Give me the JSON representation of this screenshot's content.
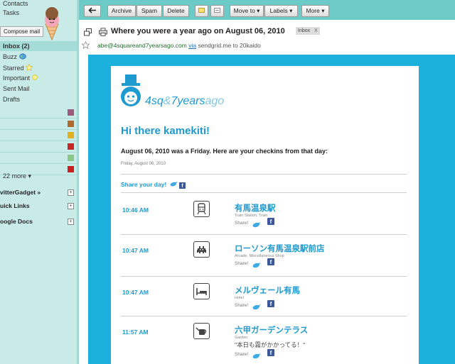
{
  "sidebar": {
    "nav": [
      "Contacts",
      "Tasks"
    ],
    "compose_label": "Compose mail",
    "inbox_label": "Inbox (2)",
    "buzz_label": "Buzz",
    "starred_label": "Starred",
    "important_label": "Important",
    "sent_label": "Sent Mail",
    "drafts_label": "Drafts",
    "label_colors": [
      "#9c5a7d",
      "#b06a2c",
      "#e0b021",
      "#c62828",
      "#8bc689",
      "#cc1f1f"
    ],
    "more_label": "22 more ▾",
    "gadgets": [
      "vitterGadget »",
      "uick Links",
      "oogle Docs"
    ]
  },
  "toolbar": {
    "back_icon": "back-arrow-icon",
    "archive": "Archive",
    "spam": "Spam",
    "delete": "Delete",
    "move_to": "Move to ▾",
    "labels": "Labels ▾",
    "more": "More ▾"
  },
  "header": {
    "subject": "Where you were a year ago on August 06, 2010",
    "inbox_tag": "Inbox",
    "inbox_tag_x": "X",
    "sender": "abe@4squareand7yearsago.com",
    "via": "via",
    "via_domain": "sendgrid.me",
    "to": "to 20kaido"
  },
  "email": {
    "logo_text_a": "4sq",
    "logo_text_amp": "&",
    "logo_text_b": "7years",
    "logo_text_c": "ago",
    "greeting": "Hi there kamekiti!",
    "intro": "August 06, 2010 was a Friday. Here are your checkins from that day:",
    "date": "Friday, August 06, 2010",
    "share_day": "Share your day!",
    "accent": "#1d9ad0",
    "frame_color": "#1cb1dd"
  },
  "checkins": [
    {
      "time": "10:46 AM",
      "venue": "有馬温泉駅",
      "category": "Train Station, Train",
      "share": "Share!",
      "icon": "train-icon"
    },
    {
      "time": "10:47 AM",
      "venue": "ローソン有馬温泉駅前店",
      "category": "Arcade, Miscellaneous Shop",
      "share": "Share!",
      "icon": "arcade-invader-icon"
    },
    {
      "time": "10:47 AM",
      "venue": "メルヴェール有馬",
      "category": "Hotel",
      "share": "Share!",
      "icon": "hotel-bed-icon"
    },
    {
      "time": "11:57 AM",
      "venue": "六甲ガーデンテラス",
      "category": "Garden",
      "shout": "\"本日も霧がかかってる！\"",
      "share": "Share!",
      "icon": "watering-can-icon"
    }
  ]
}
